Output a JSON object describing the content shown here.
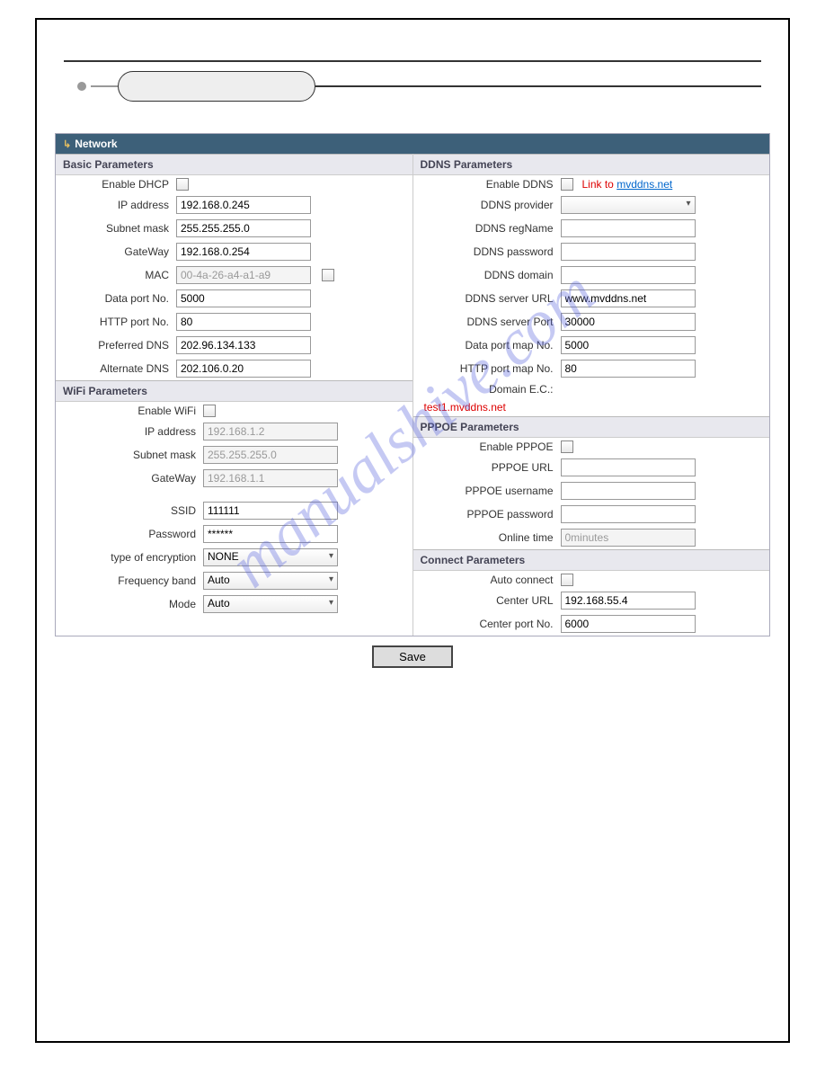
{
  "titlebar": {
    "label": "Network"
  },
  "basic": {
    "header": "Basic Parameters",
    "enable_dhcp_lbl": "Enable DHCP",
    "ip_lbl": "IP address",
    "ip_val": "192.168.0.245",
    "subnet_lbl": "Subnet mask",
    "subnet_val": "255.255.255.0",
    "gateway_lbl": "GateWay",
    "gateway_val": "192.168.0.254",
    "mac_lbl": "MAC",
    "mac_val": "00-4a-26-a4-a1-a9",
    "dataport_lbl": "Data port No.",
    "dataport_val": "5000",
    "httpport_lbl": "HTTP port No.",
    "httpport_val": "80",
    "pdns_lbl": "Preferred DNS",
    "pdns_val": "202.96.134.133",
    "adns_lbl": "Alternate DNS",
    "adns_val": "202.106.0.20"
  },
  "wifi": {
    "header": "WiFi Parameters",
    "enable_lbl": "Enable WiFi",
    "ip_lbl": "IP address",
    "ip_val": "192.168.1.2",
    "subnet_lbl": "Subnet mask",
    "subnet_val": "255.255.255.0",
    "gateway_lbl": "GateWay",
    "gateway_val": "192.168.1.1",
    "ssid_lbl": "SSID",
    "ssid_val": "111111",
    "pwd_lbl": "Password",
    "pwd_val": "******",
    "enc_lbl": "type of encryption",
    "enc_val": "NONE",
    "freq_lbl": "Frequency band",
    "freq_val": "Auto",
    "mode_lbl": "Mode",
    "mode_val": "Auto"
  },
  "ddns": {
    "header": "DDNS Parameters",
    "enable_lbl": "Enable DDNS",
    "linkto_prefix": "Link to ",
    "linkto_url": "mvddns.net",
    "provider_lbl": "DDNS provider",
    "provider_val": "",
    "regname_lbl": "DDNS regName",
    "regname_val": "",
    "pwd_lbl": "DDNS password",
    "pwd_val": "",
    "domain_lbl": "DDNS domain",
    "domain_val": "",
    "server_lbl": "DDNS server URL",
    "server_val": "www.mvddns.net",
    "port_lbl": "DDNS server Port",
    "port_val": "30000",
    "dpmap_lbl": "Data port map No.",
    "dpmap_val": "5000",
    "hpmap_lbl": "HTTP port map No.",
    "hpmap_val": "80",
    "ec_lbl": "Domain E.C.:",
    "ec_val": "test1.mvddns.net"
  },
  "pppoe": {
    "header": "PPPOE Parameters",
    "enable_lbl": "Enable PPPOE",
    "url_lbl": "PPPOE URL",
    "url_val": "",
    "user_lbl": "PPPOE username",
    "user_val": "",
    "pwd_lbl": "PPPOE password",
    "pwd_val": "",
    "online_lbl": "Online time",
    "online_val": "0minutes"
  },
  "connect": {
    "header": "Connect Parameters",
    "auto_lbl": "Auto connect",
    "url_lbl": "Center URL",
    "url_val": "192.168.55.4",
    "port_lbl": "Center port No.",
    "port_val": "6000"
  },
  "buttons": {
    "save": "Save"
  },
  "watermark": "manualshive.com"
}
